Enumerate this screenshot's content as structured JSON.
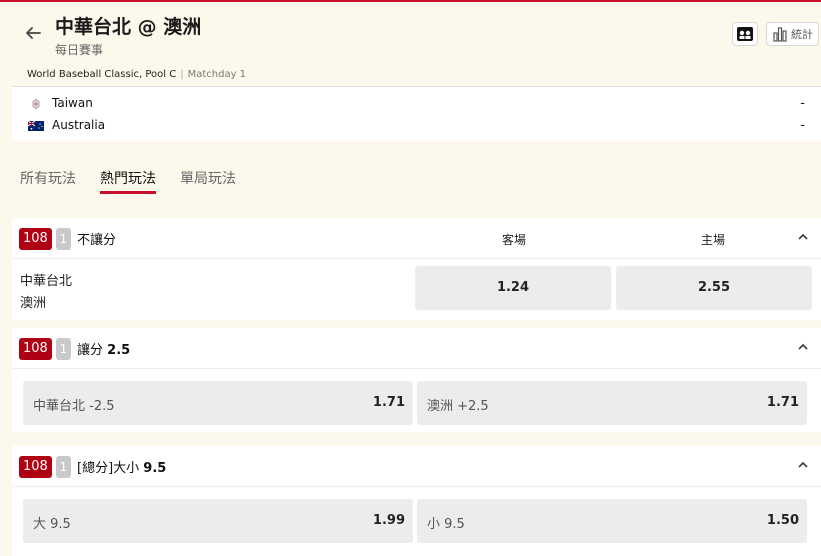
{
  "header": {
    "title": "中華台北 @ 澳洲",
    "subtitle": "每日賽事",
    "stats_label": "統計"
  },
  "competition": {
    "name": "World Baseball Classic, Pool C",
    "matchday": "Matchday 1"
  },
  "teams": [
    {
      "name": "Taiwan",
      "score": "-"
    },
    {
      "name": "Australia",
      "score": "-"
    }
  ],
  "tabs": [
    "所有玩法",
    "熱門玩法",
    "單局玩法"
  ],
  "active_tab": "熱門玩法",
  "markets": [
    {
      "id": "108",
      "count": "1",
      "title": "不讓分",
      "columns": [
        "客場",
        "主場"
      ],
      "teams": [
        "中華台北",
        "澳洲"
      ],
      "odds": [
        "1.24",
        "2.55"
      ]
    },
    {
      "id": "108",
      "count": "1",
      "title": "讓分",
      "title_value": "2.5",
      "selections": [
        {
          "label": "中華台北 -2.5",
          "odd": "1.71"
        },
        {
          "label": "澳洲 +2.5",
          "odd": "1.71"
        }
      ]
    },
    {
      "id": "108",
      "count": "1",
      "title": "[總分]大小",
      "title_value": "9.5",
      "selections": [
        {
          "label": "大 9.5",
          "odd": "1.99"
        },
        {
          "label": "小 9.5",
          "odd": "1.50"
        }
      ]
    }
  ],
  "colors": {
    "accent": "#c8102e",
    "badge": "#b00014",
    "badge_count": "#c9c9c9",
    "background": "#fdf8ec",
    "odd_button": "#ececec"
  },
  "icons": [
    "back-arrow-icon",
    "matchup-icon",
    "bar-chart-icon",
    "taiwan-flag-icon",
    "australia-flag-icon",
    "chevron-up-icon"
  ]
}
